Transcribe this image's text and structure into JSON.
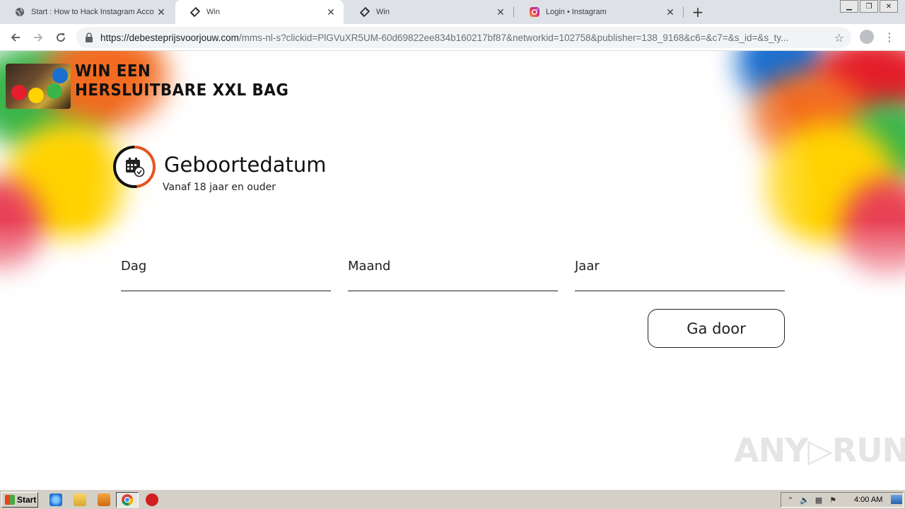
{
  "browser": {
    "tabs": [
      {
        "title": "Start : How to Hack Instagram Acco",
        "icon": "globe-icon",
        "active": false
      },
      {
        "title": "Win",
        "icon": "ticket-icon",
        "active": true
      },
      {
        "title": "Win",
        "icon": "ticket-icon",
        "active": false
      },
      {
        "title": "Login • Instagram",
        "icon": "instagram-icon",
        "active": false
      }
    ],
    "url_host": "https://debesteprijsvoorjouw.com",
    "url_path": "/mms-nl-s?clickid=PlGVuXR5UM-60d69822ee834b160217bf87&networkid=102758&publisher=138_9168&c6=&c7=&s_id=&s_ty..."
  },
  "page": {
    "promo_line1": "WIN EEN",
    "promo_line2": "HERSLUITBARE XXL BAG",
    "heading": "Geboortedatum",
    "subheading": "Vanaf 18 jaar en ouder",
    "fields": {
      "day": "Dag",
      "month": "Maand",
      "year": "Jaar"
    },
    "continue_label": "Ga door",
    "watermark": "ANY▷RUN"
  },
  "taskbar": {
    "start_label": "Start",
    "clock": "4:00 AM"
  },
  "colors": {
    "accent": "#e8531f",
    "tab_strip": "#dee1e6",
    "taskbar": "#d4d0c8"
  }
}
